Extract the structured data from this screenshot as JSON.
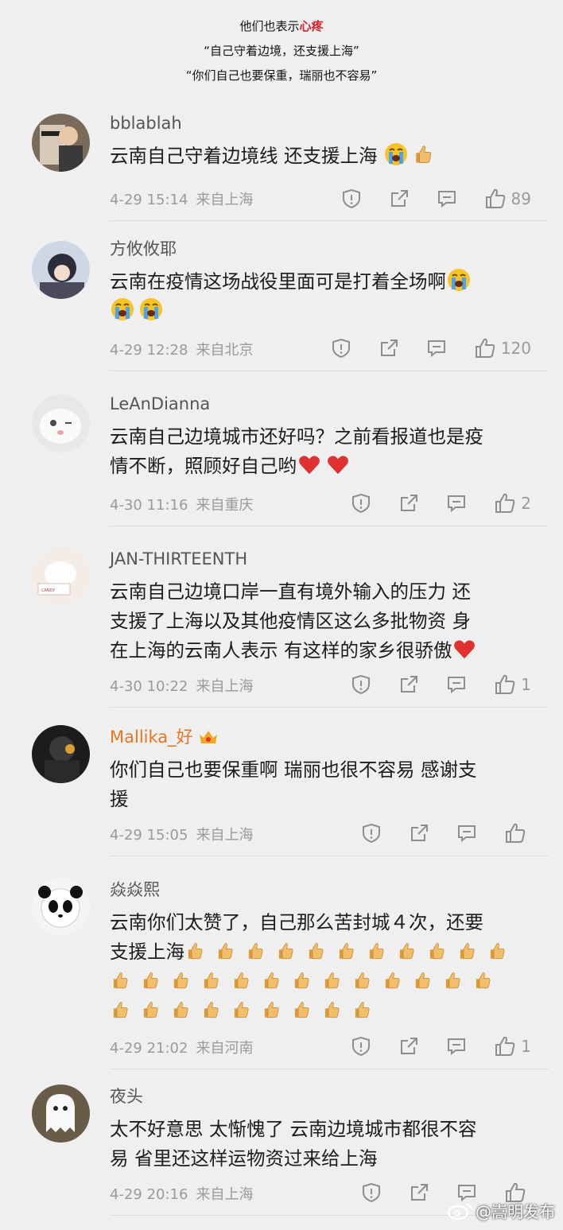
{
  "header": {
    "line1_prefix": "他们也表示",
    "line1_highlight": "心疼",
    "line2": "“自己守着边境，还支援上海”",
    "line3": "“你们自己也要保重，瑞丽也不容易”"
  },
  "colors": {
    "highlight": "#d9222a",
    "vip_name": "#e8761f",
    "heart": "#e03030"
  },
  "comments": [
    {
      "user": "bblablah",
      "lines": [
        "云南自己守着边境线 还支援上海"
      ],
      "date": "4-29 15:14",
      "source": "来自上海",
      "likes": "89",
      "avatar_icon": "playboy-avatar"
    },
    {
      "user": "方攸攸耶",
      "lines": [
        "云南在疫情这场战役里面可是打着全场啊"
      ],
      "date": "4-29 12:28",
      "source": "来自北京",
      "likes": "120",
      "avatar_icon": "anime-avatar"
    },
    {
      "user": "LeAnDianna",
      "lines": [
        "云南自己边境城市还好吗？之前看报道也是疫",
        "情不断，照顾好自己哟"
      ],
      "date": "4-30 11:16",
      "source": "来自重庆",
      "likes": "2",
      "avatar_icon": "cat-avatar"
    },
    {
      "user": "JAN-THIRTEENTH",
      "lines": [
        "云南自己边境口岸一直有境外输入的压力 还",
        "支援了上海以及其他疫情区这么多批物资 身",
        "在上海的云南人表示 有这样的家乡很骄傲"
      ],
      "date": "4-30 10:22",
      "source": "来自上海",
      "likes": "1",
      "avatar_icon": "cat-photo-avatar"
    },
    {
      "user": "Mallika_好",
      "lines": [
        "你们自己也要保重啊 瑞丽也很不容易 感谢支",
        "援"
      ],
      "date": "4-29 15:05",
      "source": "来自上海",
      "likes": "",
      "avatar_icon": "figure-avatar"
    },
    {
      "user": "焱焱熙",
      "lines": [
        "云南你们太赞了，自己那么苦封城４次，还要",
        "支援上海"
      ],
      "date": "4-29 21:02",
      "source": "来自河南",
      "likes": "1",
      "avatar_icon": "panda-avatar"
    },
    {
      "user": "夜头",
      "lines": [
        "太不好意思 太惭愧了 云南边境城市都很不容",
        "易 省里还这样运物资过来给上海"
      ],
      "date": "4-29 20:16",
      "source": "来自上海",
      "likes": "",
      "avatar_icon": "ghost-avatar"
    }
  ],
  "watermark": "@嵩明发布"
}
